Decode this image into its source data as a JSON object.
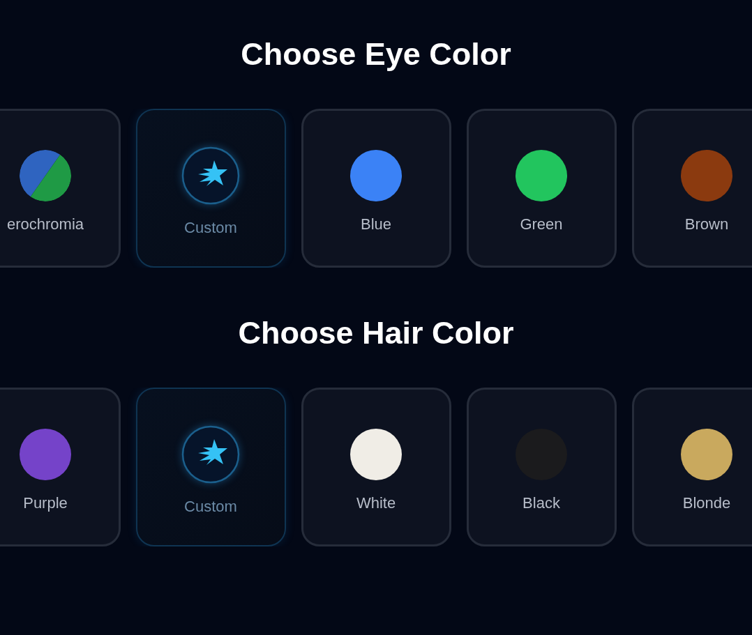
{
  "sections": [
    {
      "title": "Choose Eye Color",
      "options": [
        {
          "kind": "split",
          "label": "erochromia",
          "halves": [
            {
              "color": "#2f64c0"
            },
            {
              "color": "#1f9a45"
            }
          ],
          "selected": false
        },
        {
          "kind": "custom",
          "label": "Custom",
          "selected": true
        },
        {
          "kind": "swatch",
          "label": "Blue",
          "color": "#3b82f6",
          "selected": false
        },
        {
          "kind": "swatch",
          "label": "Green",
          "color": "#22c55e",
          "selected": false
        },
        {
          "kind": "swatch",
          "label": "Brown",
          "color": "#8b3a0f",
          "selected": false
        }
      ]
    },
    {
      "title": "Choose Hair Color",
      "options": [
        {
          "kind": "swatch",
          "label": "Purple",
          "color": "#7543c9",
          "selected": false
        },
        {
          "kind": "custom",
          "label": "Custom",
          "selected": true
        },
        {
          "kind": "swatch",
          "label": "White",
          "color": "#f0ede6",
          "selected": false
        },
        {
          "kind": "swatch",
          "label": "Black",
          "color": "#1b1b1d",
          "selected": false
        },
        {
          "kind": "swatch",
          "label": "Blonde",
          "color": "#c9a95e",
          "selected": false
        }
      ]
    }
  ]
}
